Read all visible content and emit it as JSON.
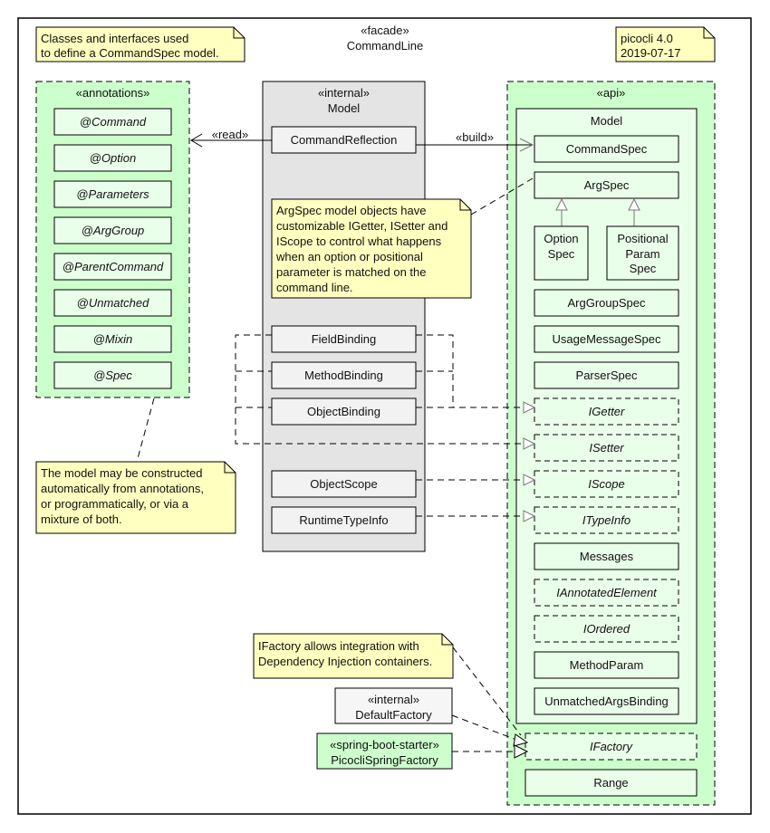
{
  "diagram": {
    "facade": {
      "stereotype": "«facade»",
      "name": "CommandLine"
    },
    "notes": {
      "intro": [
        "Classes and interfaces used",
        "to define a CommandSpec model."
      ],
      "version": [
        "picocli 4.0",
        "2019-07-17"
      ],
      "argspec": [
        "ArgSpec model objects have",
        "customizable IGetter, ISetter and",
        "IScope to control what happens",
        "when an option or positional",
        "parameter is matched on the",
        "command line."
      ],
      "model": [
        "The model may be constructed",
        "automatically from annotations,",
        "or programmatically, or via a",
        "mixture of both."
      ],
      "factory": [
        "IFactory allows integration with",
        "Dependency Injection containers."
      ]
    },
    "annotations_package": {
      "stereotype": "«annotations»",
      "items": [
        "@Command",
        "@Option",
        "@Parameters",
        "@ArgGroup",
        "@ParentCommand",
        "@Unmatched",
        "@Mixin",
        "@Spec"
      ]
    },
    "internal_package": {
      "stereotype": "«internal»",
      "name": "Model",
      "reflection": "CommandReflection",
      "bindings": [
        "FieldBinding",
        "MethodBinding",
        "ObjectBinding"
      ],
      "scope": "ObjectScope",
      "typeinfo": "RuntimeTypeInfo"
    },
    "relations": {
      "read": "«read»",
      "build": "«build»"
    },
    "api_package": {
      "stereotype": "«api»",
      "model_title": "Model",
      "command_spec": "CommandSpec",
      "arg_spec": "ArgSpec",
      "option_spec": [
        "Option",
        "Spec"
      ],
      "positional_spec": [
        "Positional",
        "Param",
        "Spec"
      ],
      "classes": [
        {
          "name": "ArgGroupSpec",
          "interface": false
        },
        {
          "name": "UsageMessageSpec",
          "interface": false
        },
        {
          "name": "ParserSpec",
          "interface": false
        },
        {
          "name": "IGetter",
          "interface": true
        },
        {
          "name": "ISetter",
          "interface": true
        },
        {
          "name": "IScope",
          "interface": true
        },
        {
          "name": "ITypeInfo",
          "interface": true
        },
        {
          "name": "Messages",
          "interface": false
        },
        {
          "name": "IAnnotatedElement",
          "interface": true
        },
        {
          "name": "IOrdered",
          "interface": true
        },
        {
          "name": "MethodParam",
          "interface": false
        },
        {
          "name": "UnmatchedArgsBinding",
          "interface": false
        }
      ],
      "ifactory": "IFactory",
      "range": "Range"
    },
    "default_factory": {
      "stereotype": "«internal»",
      "name": "DefaultFactory"
    },
    "spring_factory": {
      "stereotype": "«spring-boot-starter»",
      "name": "PicocliSpringFactory"
    }
  }
}
